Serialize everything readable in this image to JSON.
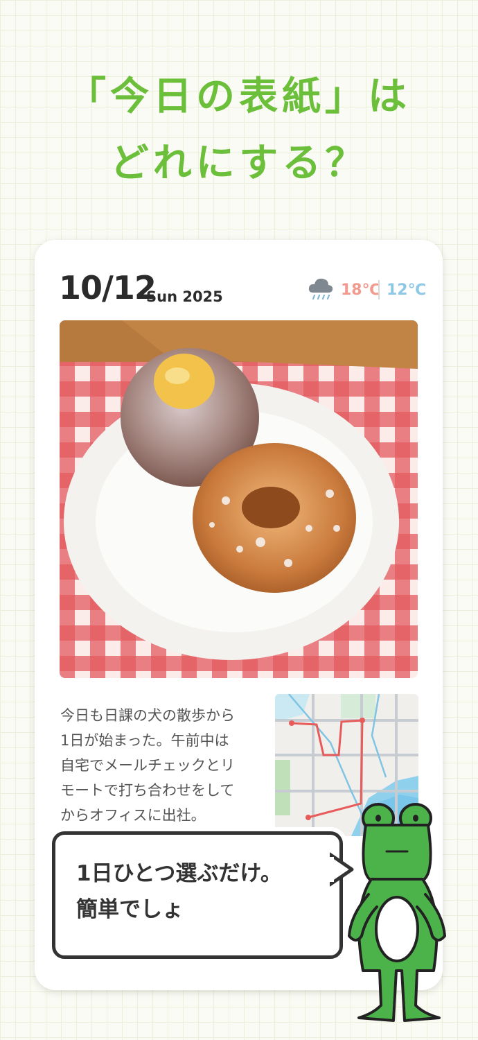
{
  "headline": {
    "line1": "「今日の表紙」は",
    "line2": "どれにする？"
  },
  "card": {
    "date": "10/12",
    "weekday_year": "Sun 2025",
    "weather_icon": "rain-cloud-icon",
    "temp_high": "18℃",
    "temp_low": "12℃",
    "photo": "donuts-on-plate-photo",
    "diary_text": "今日も日課の犬の散歩から\n1日が始まった。午前中は\n自宅でメールチェックとリ\nモートで打ち合わせをして\nからオフィスに出社。",
    "map": "route-map"
  },
  "bubble": {
    "text": "1日ひとつ選ぶだけ。\n簡単でしょ"
  },
  "colors": {
    "headline": "#6cbf3a",
    "temp_high": "#f39a8f",
    "temp_low": "#8ec8e6",
    "frog": "#4cb24a"
  }
}
